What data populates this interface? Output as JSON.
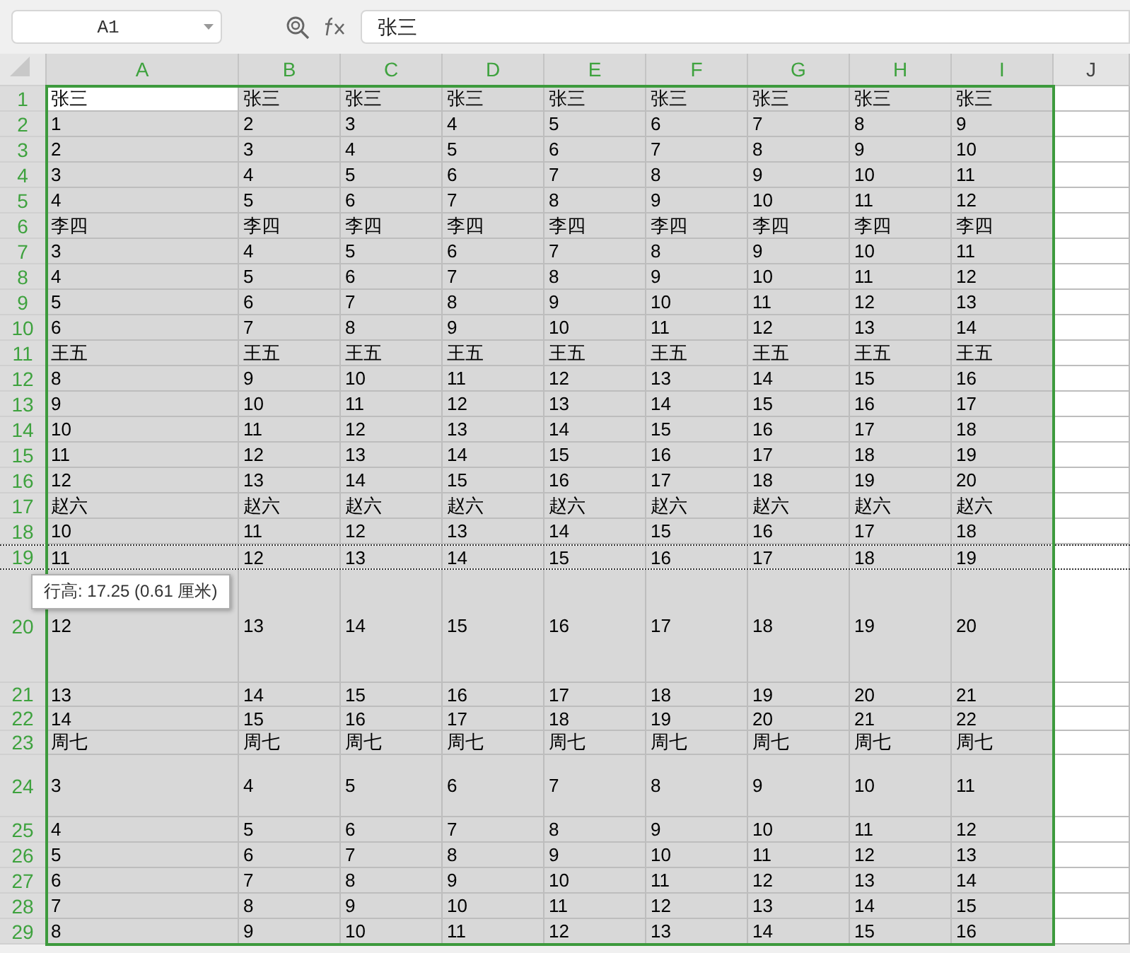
{
  "name_box": "A1",
  "formula": "张三",
  "columns": [
    {
      "label": "A",
      "selected": true
    },
    {
      "label": "B",
      "selected": true
    },
    {
      "label": "C",
      "selected": true
    },
    {
      "label": "D",
      "selected": true
    },
    {
      "label": "E",
      "selected": true
    },
    {
      "label": "F",
      "selected": true
    },
    {
      "label": "G",
      "selected": true
    },
    {
      "label": "H",
      "selected": true
    },
    {
      "label": "I",
      "selected": true
    },
    {
      "label": "J",
      "selected": false
    }
  ],
  "rows": [
    {
      "number": "1",
      "kind": "normal",
      "resizing": false,
      "cells": [
        {
          "text": "张三",
          "active": true
        },
        {
          "text": "张三",
          "active": false
        },
        {
          "text": "张三",
          "active": false
        },
        {
          "text": "张三",
          "active": false
        },
        {
          "text": "张三",
          "active": false
        },
        {
          "text": "张三",
          "active": false
        },
        {
          "text": "张三",
          "active": false
        },
        {
          "text": "张三",
          "active": false
        },
        {
          "text": "张三",
          "active": false
        }
      ]
    },
    {
      "number": "2",
      "kind": "normal",
      "resizing": false,
      "cells": [
        {
          "text": "1",
          "active": false
        },
        {
          "text": "2",
          "active": false
        },
        {
          "text": "3",
          "active": false
        },
        {
          "text": "4",
          "active": false
        },
        {
          "text": "5",
          "active": false
        },
        {
          "text": "6",
          "active": false
        },
        {
          "text": "7",
          "active": false
        },
        {
          "text": "8",
          "active": false
        },
        {
          "text": "9",
          "active": false
        }
      ]
    },
    {
      "number": "3",
      "kind": "normal",
      "resizing": false,
      "cells": [
        {
          "text": "2",
          "active": false
        },
        {
          "text": "3",
          "active": false
        },
        {
          "text": "4",
          "active": false
        },
        {
          "text": "5",
          "active": false
        },
        {
          "text": "6",
          "active": false
        },
        {
          "text": "7",
          "active": false
        },
        {
          "text": "8",
          "active": false
        },
        {
          "text": "9",
          "active": false
        },
        {
          "text": "10",
          "active": false
        }
      ]
    },
    {
      "number": "4",
      "kind": "normal",
      "resizing": false,
      "cells": [
        {
          "text": "3",
          "active": false
        },
        {
          "text": "4",
          "active": false
        },
        {
          "text": "5",
          "active": false
        },
        {
          "text": "6",
          "active": false
        },
        {
          "text": "7",
          "active": false
        },
        {
          "text": "8",
          "active": false
        },
        {
          "text": "9",
          "active": false
        },
        {
          "text": "10",
          "active": false
        },
        {
          "text": "11",
          "active": false
        }
      ]
    },
    {
      "number": "5",
      "kind": "normal",
      "resizing": false,
      "cells": [
        {
          "text": "4",
          "active": false
        },
        {
          "text": "5",
          "active": false
        },
        {
          "text": "6",
          "active": false
        },
        {
          "text": "7",
          "active": false
        },
        {
          "text": "8",
          "active": false
        },
        {
          "text": "9",
          "active": false
        },
        {
          "text": "10",
          "active": false
        },
        {
          "text": "11",
          "active": false
        },
        {
          "text": "12",
          "active": false
        }
      ]
    },
    {
      "number": "6",
      "kind": "normal",
      "resizing": false,
      "cells": [
        {
          "text": "李四",
          "active": false
        },
        {
          "text": "李四",
          "active": false
        },
        {
          "text": "李四",
          "active": false
        },
        {
          "text": "李四",
          "active": false
        },
        {
          "text": "李四",
          "active": false
        },
        {
          "text": "李四",
          "active": false
        },
        {
          "text": "李四",
          "active": false
        },
        {
          "text": "李四",
          "active": false
        },
        {
          "text": "李四",
          "active": false
        }
      ]
    },
    {
      "number": "7",
      "kind": "normal",
      "resizing": false,
      "cells": [
        {
          "text": "3",
          "active": false
        },
        {
          "text": "4",
          "active": false
        },
        {
          "text": "5",
          "active": false
        },
        {
          "text": "6",
          "active": false
        },
        {
          "text": "7",
          "active": false
        },
        {
          "text": "8",
          "active": false
        },
        {
          "text": "9",
          "active": false
        },
        {
          "text": "10",
          "active": false
        },
        {
          "text": "11",
          "active": false
        }
      ]
    },
    {
      "number": "8",
      "kind": "normal",
      "resizing": false,
      "cells": [
        {
          "text": "4",
          "active": false
        },
        {
          "text": "5",
          "active": false
        },
        {
          "text": "6",
          "active": false
        },
        {
          "text": "7",
          "active": false
        },
        {
          "text": "8",
          "active": false
        },
        {
          "text": "9",
          "active": false
        },
        {
          "text": "10",
          "active": false
        },
        {
          "text": "11",
          "active": false
        },
        {
          "text": "12",
          "active": false
        }
      ]
    },
    {
      "number": "9",
      "kind": "normal",
      "resizing": false,
      "cells": [
        {
          "text": "5",
          "active": false
        },
        {
          "text": "6",
          "active": false
        },
        {
          "text": "7",
          "active": false
        },
        {
          "text": "8",
          "active": false
        },
        {
          "text": "9",
          "active": false
        },
        {
          "text": "10",
          "active": false
        },
        {
          "text": "11",
          "active": false
        },
        {
          "text": "12",
          "active": false
        },
        {
          "text": "13",
          "active": false
        }
      ]
    },
    {
      "number": "10",
      "kind": "normal",
      "resizing": false,
      "cells": [
        {
          "text": "6",
          "active": false
        },
        {
          "text": "7",
          "active": false
        },
        {
          "text": "8",
          "active": false
        },
        {
          "text": "9",
          "active": false
        },
        {
          "text": "10",
          "active": false
        },
        {
          "text": "11",
          "active": false
        },
        {
          "text": "12",
          "active": false
        },
        {
          "text": "13",
          "active": false
        },
        {
          "text": "14",
          "active": false
        }
      ]
    },
    {
      "number": "11",
      "kind": "normal",
      "resizing": false,
      "cells": [
        {
          "text": "王五",
          "active": false
        },
        {
          "text": "王五",
          "active": false
        },
        {
          "text": "王五",
          "active": false
        },
        {
          "text": "王五",
          "active": false
        },
        {
          "text": "王五",
          "active": false
        },
        {
          "text": "王五",
          "active": false
        },
        {
          "text": "王五",
          "active": false
        },
        {
          "text": "王五",
          "active": false
        },
        {
          "text": "王五",
          "active": false
        }
      ]
    },
    {
      "number": "12",
      "kind": "normal",
      "resizing": false,
      "cells": [
        {
          "text": "8",
          "active": false
        },
        {
          "text": "9",
          "active": false
        },
        {
          "text": "10",
          "active": false
        },
        {
          "text": "11",
          "active": false
        },
        {
          "text": "12",
          "active": false
        },
        {
          "text": "13",
          "active": false
        },
        {
          "text": "14",
          "active": false
        },
        {
          "text": "15",
          "active": false
        },
        {
          "text": "16",
          "active": false
        }
      ]
    },
    {
      "number": "13",
      "kind": "normal",
      "resizing": false,
      "cells": [
        {
          "text": "9",
          "active": false
        },
        {
          "text": "10",
          "active": false
        },
        {
          "text": "11",
          "active": false
        },
        {
          "text": "12",
          "active": false
        },
        {
          "text": "13",
          "active": false
        },
        {
          "text": "14",
          "active": false
        },
        {
          "text": "15",
          "active": false
        },
        {
          "text": "16",
          "active": false
        },
        {
          "text": "17",
          "active": false
        }
      ]
    },
    {
      "number": "14",
      "kind": "normal",
      "resizing": false,
      "cells": [
        {
          "text": "10",
          "active": false
        },
        {
          "text": "11",
          "active": false
        },
        {
          "text": "12",
          "active": false
        },
        {
          "text": "13",
          "active": false
        },
        {
          "text": "14",
          "active": false
        },
        {
          "text": "15",
          "active": false
        },
        {
          "text": "16",
          "active": false
        },
        {
          "text": "17",
          "active": false
        },
        {
          "text": "18",
          "active": false
        }
      ]
    },
    {
      "number": "15",
      "kind": "normal",
      "resizing": false,
      "cells": [
        {
          "text": "11",
          "active": false
        },
        {
          "text": "12",
          "active": false
        },
        {
          "text": "13",
          "active": false
        },
        {
          "text": "14",
          "active": false
        },
        {
          "text": "15",
          "active": false
        },
        {
          "text": "16",
          "active": false
        },
        {
          "text": "17",
          "active": false
        },
        {
          "text": "18",
          "active": false
        },
        {
          "text": "19",
          "active": false
        }
      ]
    },
    {
      "number": "16",
      "kind": "normal",
      "resizing": false,
      "cells": [
        {
          "text": "12",
          "active": false
        },
        {
          "text": "13",
          "active": false
        },
        {
          "text": "14",
          "active": false
        },
        {
          "text": "15",
          "active": false
        },
        {
          "text": "16",
          "active": false
        },
        {
          "text": "17",
          "active": false
        },
        {
          "text": "18",
          "active": false
        },
        {
          "text": "19",
          "active": false
        },
        {
          "text": "20",
          "active": false
        }
      ]
    },
    {
      "number": "17",
      "kind": "normal",
      "resizing": false,
      "cells": [
        {
          "text": "赵六",
          "active": false
        },
        {
          "text": "赵六",
          "active": false
        },
        {
          "text": "赵六",
          "active": false
        },
        {
          "text": "赵六",
          "active": false
        },
        {
          "text": "赵六",
          "active": false
        },
        {
          "text": "赵六",
          "active": false
        },
        {
          "text": "赵六",
          "active": false
        },
        {
          "text": "赵六",
          "active": false
        },
        {
          "text": "赵六",
          "active": false
        }
      ]
    },
    {
      "number": "18",
      "kind": "normal",
      "resizing": false,
      "cells": [
        {
          "text": "10",
          "active": false
        },
        {
          "text": "11",
          "active": false
        },
        {
          "text": "12",
          "active": false
        },
        {
          "text": "13",
          "active": false
        },
        {
          "text": "14",
          "active": false
        },
        {
          "text": "15",
          "active": false
        },
        {
          "text": "16",
          "active": false
        },
        {
          "text": "17",
          "active": false
        },
        {
          "text": "18",
          "active": false
        }
      ]
    },
    {
      "number": "19",
      "kind": "normal",
      "resizing": true,
      "cells": [
        {
          "text": "11",
          "active": false
        },
        {
          "text": "12",
          "active": false
        },
        {
          "text": "13",
          "active": false
        },
        {
          "text": "14",
          "active": false
        },
        {
          "text": "15",
          "active": false
        },
        {
          "text": "16",
          "active": false
        },
        {
          "text": "17",
          "active": false
        },
        {
          "text": "18",
          "active": false
        },
        {
          "text": "19",
          "active": false
        }
      ]
    },
    {
      "number": "20",
      "kind": "tallest",
      "resizing": false,
      "cells": [
        {
          "text": "12",
          "active": false
        },
        {
          "text": "13",
          "active": false
        },
        {
          "text": "14",
          "active": false
        },
        {
          "text": "15",
          "active": false
        },
        {
          "text": "16",
          "active": false
        },
        {
          "text": "17",
          "active": false
        },
        {
          "text": "18",
          "active": false
        },
        {
          "text": "19",
          "active": false
        },
        {
          "text": "20",
          "active": false
        }
      ]
    },
    {
      "number": "21",
      "kind": "short",
      "resizing": false,
      "cells": [
        {
          "text": "13",
          "active": false
        },
        {
          "text": "14",
          "active": false
        },
        {
          "text": "15",
          "active": false
        },
        {
          "text": "16",
          "active": false
        },
        {
          "text": "17",
          "active": false
        },
        {
          "text": "18",
          "active": false
        },
        {
          "text": "19",
          "active": false
        },
        {
          "text": "20",
          "active": false
        },
        {
          "text": "21",
          "active": false
        }
      ]
    },
    {
      "number": "22",
      "kind": "short",
      "resizing": false,
      "cells": [
        {
          "text": "14",
          "active": false
        },
        {
          "text": "15",
          "active": false
        },
        {
          "text": "16",
          "active": false
        },
        {
          "text": "17",
          "active": false
        },
        {
          "text": "18",
          "active": false
        },
        {
          "text": "19",
          "active": false
        },
        {
          "text": "20",
          "active": false
        },
        {
          "text": "21",
          "active": false
        },
        {
          "text": "22",
          "active": false
        }
      ]
    },
    {
      "number": "23",
      "kind": "short",
      "resizing": false,
      "cells": [
        {
          "text": "周七",
          "active": false
        },
        {
          "text": "周七",
          "active": false
        },
        {
          "text": "周七",
          "active": false
        },
        {
          "text": "周七",
          "active": false
        },
        {
          "text": "周七",
          "active": false
        },
        {
          "text": "周七",
          "active": false
        },
        {
          "text": "周七",
          "active": false
        },
        {
          "text": "周七",
          "active": false
        },
        {
          "text": "周七",
          "active": false
        }
      ]
    },
    {
      "number": "24",
      "kind": "tall",
      "resizing": false,
      "cells": [
        {
          "text": "3",
          "active": false
        },
        {
          "text": "4",
          "active": false
        },
        {
          "text": "5",
          "active": false
        },
        {
          "text": "6",
          "active": false
        },
        {
          "text": "7",
          "active": false
        },
        {
          "text": "8",
          "active": false
        },
        {
          "text": "9",
          "active": false
        },
        {
          "text": "10",
          "active": false
        },
        {
          "text": "11",
          "active": false
        }
      ]
    },
    {
      "number": "25",
      "kind": "normal",
      "resizing": false,
      "cells": [
        {
          "text": "4",
          "active": false
        },
        {
          "text": "5",
          "active": false
        },
        {
          "text": "6",
          "active": false
        },
        {
          "text": "7",
          "active": false
        },
        {
          "text": "8",
          "active": false
        },
        {
          "text": "9",
          "active": false
        },
        {
          "text": "10",
          "active": false
        },
        {
          "text": "11",
          "active": false
        },
        {
          "text": "12",
          "active": false
        }
      ]
    },
    {
      "number": "26",
      "kind": "normal",
      "resizing": false,
      "cells": [
        {
          "text": "5",
          "active": false
        },
        {
          "text": "6",
          "active": false
        },
        {
          "text": "7",
          "active": false
        },
        {
          "text": "8",
          "active": false
        },
        {
          "text": "9",
          "active": false
        },
        {
          "text": "10",
          "active": false
        },
        {
          "text": "11",
          "active": false
        },
        {
          "text": "12",
          "active": false
        },
        {
          "text": "13",
          "active": false
        }
      ]
    },
    {
      "number": "27",
      "kind": "normal",
      "resizing": false,
      "cells": [
        {
          "text": "6",
          "active": false
        },
        {
          "text": "7",
          "active": false
        },
        {
          "text": "8",
          "active": false
        },
        {
          "text": "9",
          "active": false
        },
        {
          "text": "10",
          "active": false
        },
        {
          "text": "11",
          "active": false
        },
        {
          "text": "12",
          "active": false
        },
        {
          "text": "13",
          "active": false
        },
        {
          "text": "14",
          "active": false
        }
      ]
    },
    {
      "number": "28",
      "kind": "normal",
      "resizing": false,
      "cells": [
        {
          "text": "7",
          "active": false
        },
        {
          "text": "8",
          "active": false
        },
        {
          "text": "9",
          "active": false
        },
        {
          "text": "10",
          "active": false
        },
        {
          "text": "11",
          "active": false
        },
        {
          "text": "12",
          "active": false
        },
        {
          "text": "13",
          "active": false
        },
        {
          "text": "14",
          "active": false
        },
        {
          "text": "15",
          "active": false
        }
      ]
    },
    {
      "number": "29",
      "kind": "normal",
      "resizing": false,
      "cells": [
        {
          "text": "8",
          "active": false
        },
        {
          "text": "9",
          "active": false
        },
        {
          "text": "10",
          "active": false
        },
        {
          "text": "11",
          "active": false
        },
        {
          "text": "12",
          "active": false
        },
        {
          "text": "13",
          "active": false
        },
        {
          "text": "14",
          "active": false
        },
        {
          "text": "15",
          "active": false
        },
        {
          "text": "16",
          "active": false
        }
      ]
    }
  ],
  "resize_tooltip": {
    "text": "行高: 17.25 (0.61 厘米)"
  }
}
